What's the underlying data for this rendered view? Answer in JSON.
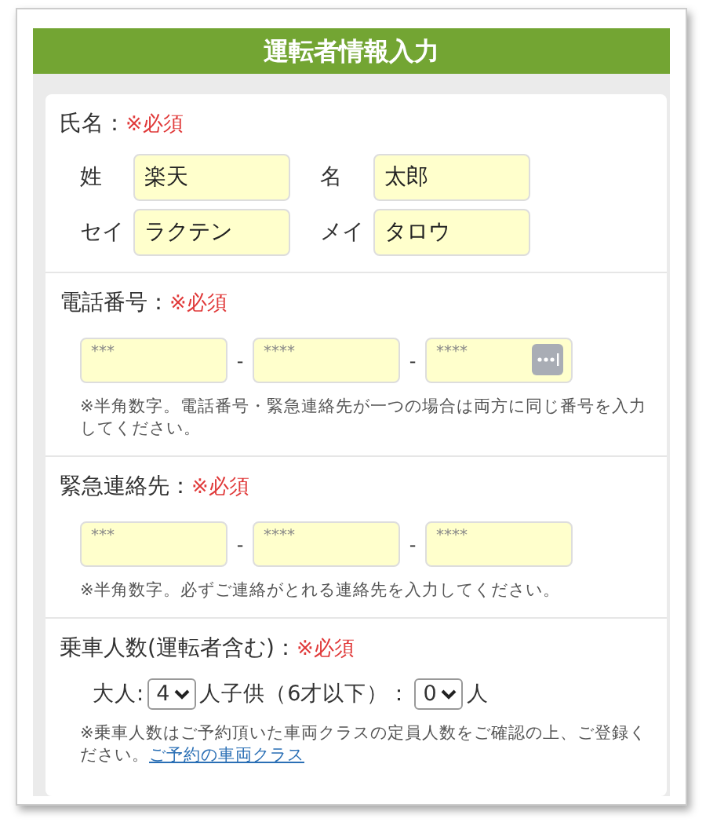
{
  "header": {
    "title": "運転者情報入力"
  },
  "name_section": {
    "label": "氏名：",
    "required": "※必須",
    "fields": [
      {
        "label": "姓",
        "value": "楽天"
      },
      {
        "label": "名",
        "value": "太郎"
      },
      {
        "label": "セイ",
        "value": "ラクテン"
      },
      {
        "label": "メイ",
        "value": "タロウ"
      }
    ]
  },
  "phone_sections": [
    {
      "label": "電話番号：",
      "required": "※必須",
      "parts": [
        {
          "placeholder": "***"
        },
        {
          "placeholder": "****"
        },
        {
          "placeholder": "****"
        }
      ],
      "separators": [
        "-",
        "-"
      ],
      "note": "※半角数字。電話番号・緊急連絡先が一つの場合は両方に同じ番号を入力してください。"
    },
    {
      "label": "緊急連絡先：",
      "required": "※必須",
      "parts": [
        {
          "placeholder": "***"
        },
        {
          "placeholder": "****"
        },
        {
          "placeholder": "****"
        }
      ],
      "separators": [
        "-",
        "-"
      ],
      "note": "※半角数字。必ずご連絡がとれる連絡先を入力してください。"
    }
  ],
  "passengers": {
    "label": "乗車人数(運転者含む)：",
    "required": "※必須",
    "adults_label": "大人:",
    "adults_value": "4",
    "children_label": "人子供（6才以下）：",
    "children_value": "0",
    "unit": "人",
    "note": "※乗車人数はご予約頂いた車両クラスの定員人数をご確認の上、ご登録ください。",
    "link": "ご予約の車両クラス"
  }
}
